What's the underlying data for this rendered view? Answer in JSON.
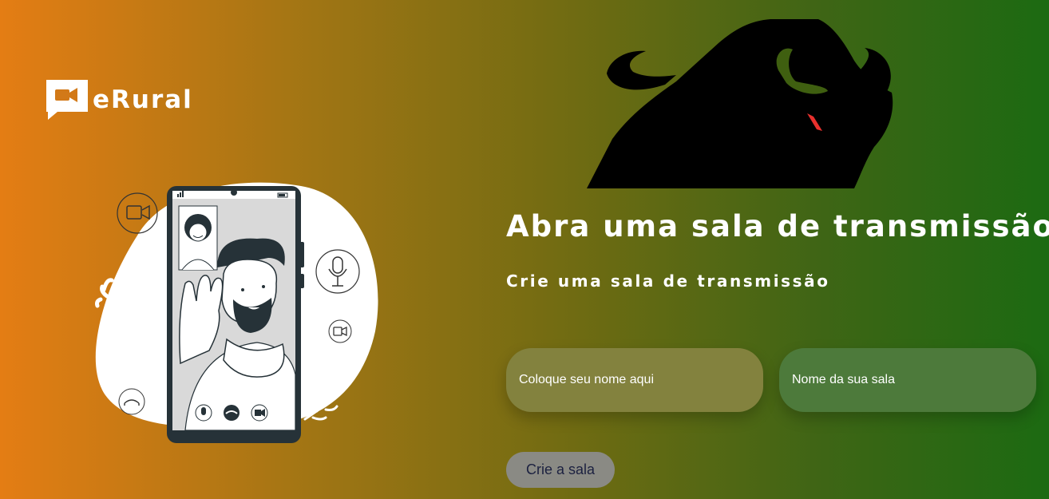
{
  "brand": {
    "name": "eRural",
    "icon": "video-chat-bubble-icon"
  },
  "hero": {
    "title": "Abra uma sala de transmissão",
    "subtitle": "Crie uma sala de transmissão"
  },
  "form": {
    "name_placeholder": "Coloque seu nome aqui",
    "room_placeholder": "Nome da sua sala",
    "submit_label": "Crie a sala"
  },
  "colors": {
    "gradient_start": "#e47d14",
    "gradient_end": "#1c6a12",
    "bull_eye": "#e8302d"
  }
}
